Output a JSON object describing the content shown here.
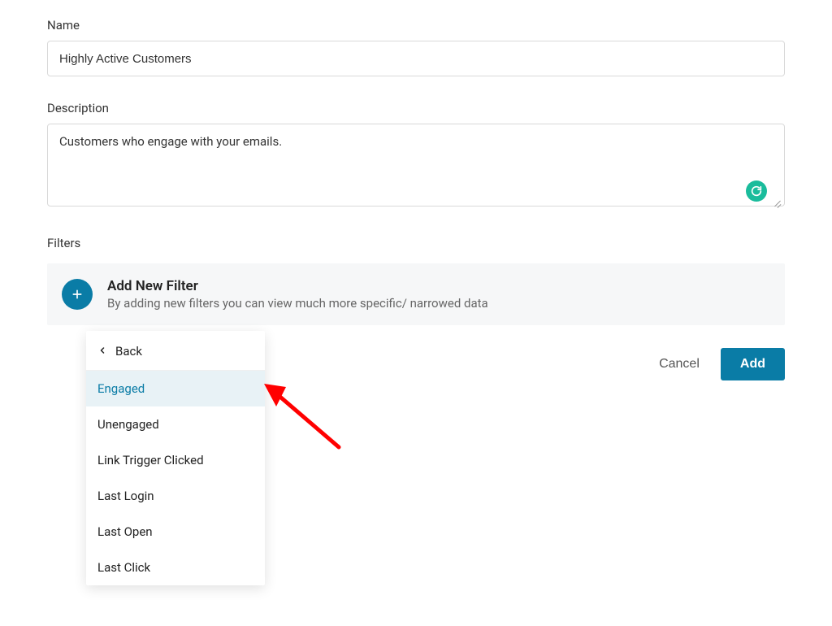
{
  "name": {
    "label": "Name",
    "value": "Highly Active Customers"
  },
  "description": {
    "label": "Description",
    "value": "Customers who engage with your emails."
  },
  "filters": {
    "label": "Filters",
    "add_title": "Add New Filter",
    "add_subtitle": "By adding new filters you can view much more specific/ narrowed data"
  },
  "actions": {
    "cancel": "Cancel",
    "add": "Add"
  },
  "dropdown": {
    "back": "Back",
    "items": [
      "Engaged",
      "Unengaged",
      "Link Trigger Clicked",
      "Last Login",
      "Last Open",
      "Last Click"
    ]
  }
}
